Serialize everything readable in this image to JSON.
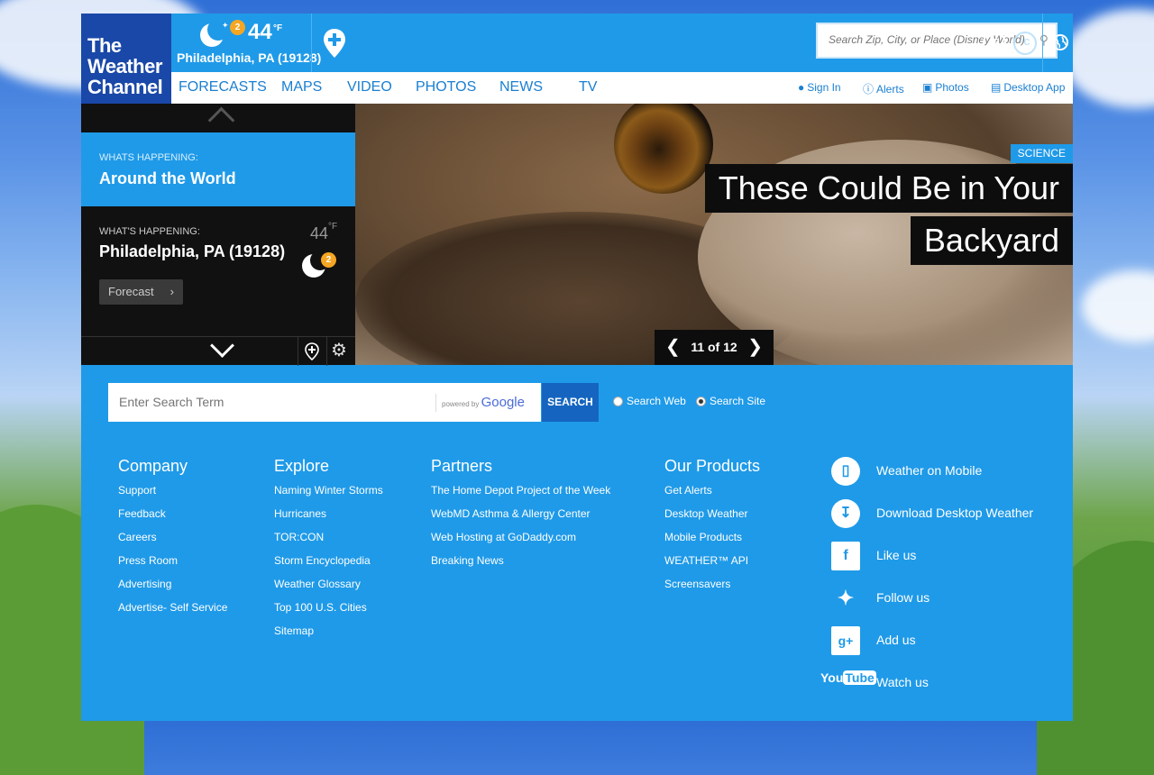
{
  "header": {
    "logo_lines": [
      "The",
      "Weather",
      "Channel"
    ],
    "temp": "44",
    "temp_unit": "°F",
    "alert_count": "2",
    "location": "Philadelphia, PA (19128)",
    "search_placeholder": "Search Zip, City, or Place (Disney World)",
    "unit_f": "°F",
    "unit_c": "°C"
  },
  "nav": {
    "items": [
      "FORECASTS",
      "MAPS",
      "VIDEO",
      "PHOTOS",
      "NEWS",
      "TV"
    ],
    "utilities": [
      "Sign In",
      "Alerts",
      "Photos",
      "Desktop App"
    ]
  },
  "left_panel": {
    "active_kicker": "WHATS HAPPENING:",
    "active_title": "Around the World",
    "local_kicker": "WHAT'S HAPPENING:",
    "local_title": "Philadelphia, PA (19128)",
    "local_temp": "44",
    "local_temp_unit": "°F",
    "alert_count": "2",
    "forecast_label": "Forecast"
  },
  "hero": {
    "category": "SCIENCE",
    "headline_lines": [
      "These Could Be in Your",
      "Backyard"
    ],
    "pager": "11 of 12"
  },
  "footer_search": {
    "placeholder": "Enter Search Term",
    "powered": "powered by",
    "google": "Google",
    "button": "SEARCH",
    "radio_web": "Search Web",
    "radio_site": "Search Site"
  },
  "columns": [
    {
      "title": "Company",
      "links": [
        "Support",
        "Feedback",
        "Careers",
        "Press Room",
        "Advertising",
        "Advertise- Self Service"
      ]
    },
    {
      "title": "Explore",
      "links": [
        "Naming Winter Storms",
        "Hurricanes",
        "TOR:CON",
        "Storm Encyclopedia",
        "Weather Glossary",
        "Top 100 U.S. Cities",
        "Sitemap"
      ]
    },
    {
      "title": "Partners",
      "links": [
        "The Home Depot Project of the Week",
        "WebMD Asthma & Allergy Center",
        "Web Hosting at GoDaddy.com",
        "Breaking News"
      ]
    },
    {
      "title": "Our Products",
      "links": [
        "Get Alerts",
        "Desktop Weather",
        "Mobile Products",
        "WEATHER™ API",
        "Screensavers"
      ]
    }
  ],
  "social": [
    {
      "icon": "mobile-icon",
      "label": "Weather on Mobile"
    },
    {
      "icon": "download-icon",
      "label": "Download Desktop Weather"
    },
    {
      "icon": "facebook-icon",
      "label": "Like us"
    },
    {
      "icon": "twitter-icon",
      "label": "Follow us"
    },
    {
      "icon": "googleplus-icon",
      "label": "Add us"
    },
    {
      "icon": "youtube-icon",
      "label": "Watch us"
    }
  ]
}
